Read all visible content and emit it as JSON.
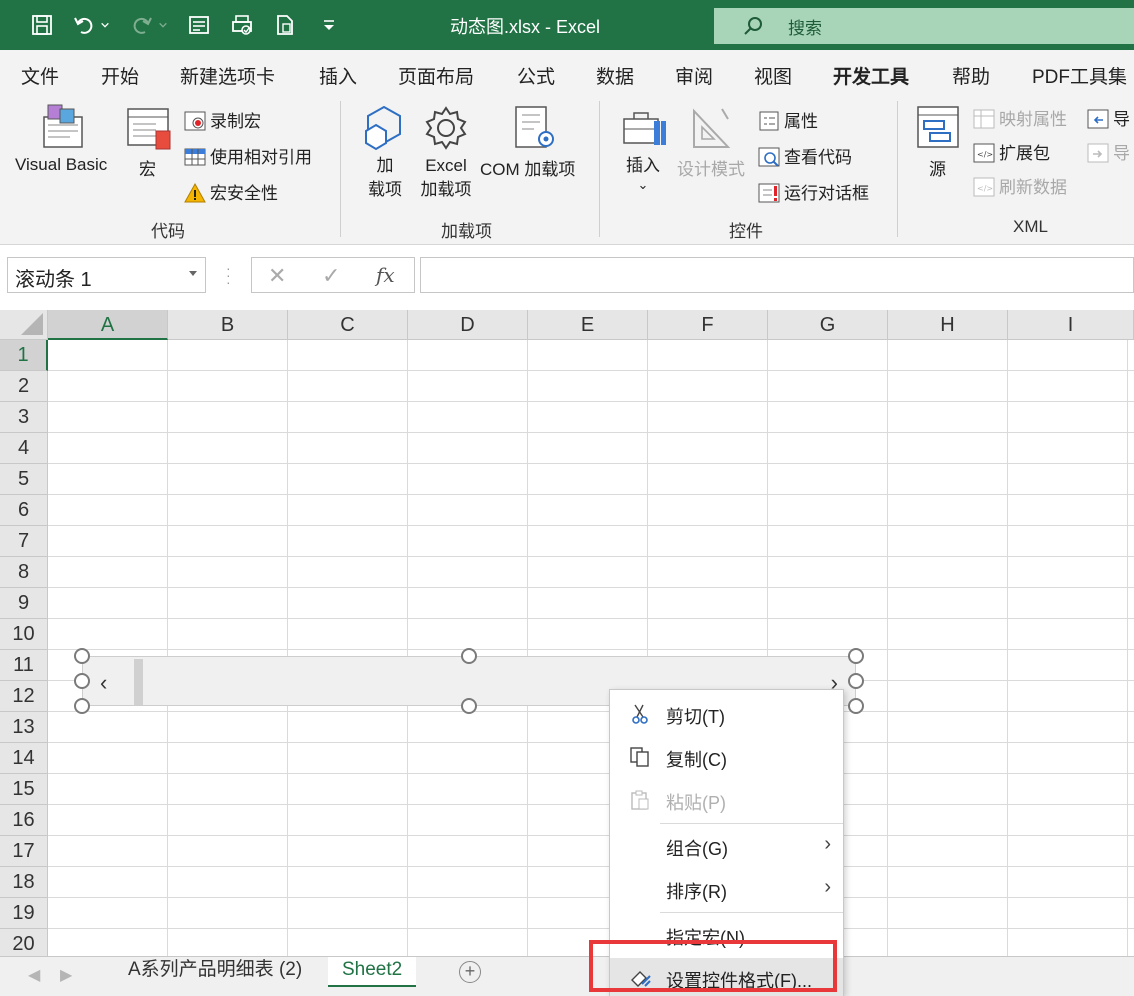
{
  "titlebar": {
    "doc_title": "动态图.xlsx  -  Excel",
    "search_placeholder": "搜索",
    "icons": [
      "save-icon",
      "undo-icon",
      "redo-icon",
      "form-icon",
      "print-preview-icon",
      "document-icon",
      "customize-quick-access-icon"
    ],
    "color": "#217346"
  },
  "tabs": [
    "文件",
    "开始",
    "新建选项卡",
    "插入",
    "页面布局",
    "公式",
    "数据",
    "审阅",
    "视图",
    "开发工具",
    "帮助",
    "PDF工具集"
  ],
  "active_tab": "开发工具",
  "ribbon": {
    "code": {
      "visual_basic": "Visual Basic",
      "macro": "宏",
      "record_macro": "录制宏",
      "relative_ref": "使用相对引用",
      "macro_security": "宏安全性",
      "label": "代码"
    },
    "addins": {
      "addins_line1": "加",
      "addins_line2": "载项",
      "excel_addins_line1": "Excel",
      "excel_addins_line2": "加载项",
      "com_addins": "COM 加载项",
      "label": "加载项"
    },
    "controls": {
      "insert": "插入",
      "design_mode": "设计模式",
      "properties": "属性",
      "view_code": "查看代码",
      "run_dialog": "运行对话框",
      "label": "控件"
    },
    "xml": {
      "source": "源",
      "map_properties": "映射属性",
      "expansion_packs": "扩展包",
      "refresh_data": "刷新数据",
      "import": "导",
      "export": "导",
      "label": "XML"
    }
  },
  "formula_bar": {
    "name_box": "滚动条 1",
    "cancel": "✕",
    "enter": "✓",
    "fx": "fx",
    "formula": ""
  },
  "grid": {
    "columns": [
      "A",
      "B",
      "C",
      "D",
      "E",
      "F",
      "G",
      "H",
      "I"
    ],
    "rows": [
      "1",
      "2",
      "3",
      "4",
      "5",
      "6",
      "7",
      "8",
      "9",
      "10",
      "11",
      "12",
      "13",
      "14",
      "15",
      "16",
      "17",
      "18",
      "19",
      "20"
    ],
    "selected_column": "A",
    "selected_row": "1"
  },
  "scrollbar_control": {
    "left_arrow": "‹",
    "right_arrow": "›"
  },
  "context_menu": {
    "items": [
      {
        "label": "剪切(T)",
        "icon": "cut-icon",
        "enabled": true
      },
      {
        "label": "复制(C)",
        "icon": "copy-icon",
        "enabled": true
      },
      {
        "label": "粘贴(P)",
        "icon": "paste-icon",
        "enabled": false
      },
      {
        "label": "组合(G)",
        "submenu": true,
        "enabled": true
      },
      {
        "label": "排序(R)",
        "submenu": true,
        "enabled": true
      },
      {
        "label": "指定宏(N)...",
        "enabled": true
      },
      {
        "label": "设置控件格式(F)...",
        "icon": "format-control-icon",
        "enabled": true,
        "highlighted": true
      }
    ],
    "submenu_arrow": "›",
    "highlight_color": "#e8383a"
  },
  "sheet_tabs": {
    "prev": "◀",
    "next": "▶",
    "sheets": [
      "A系列产品明细表 (2)",
      "Sheet2"
    ],
    "active": "Sheet2",
    "add": "+"
  }
}
